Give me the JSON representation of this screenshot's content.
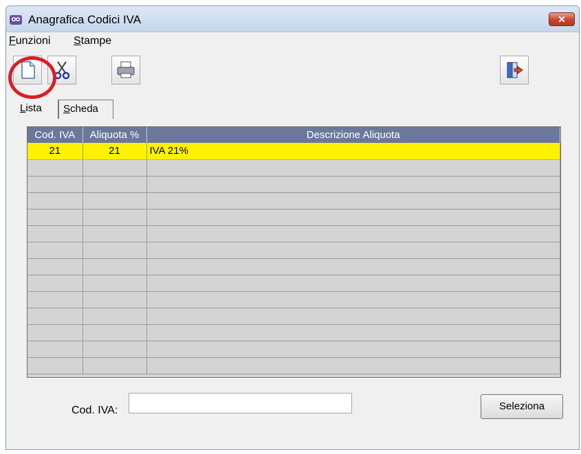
{
  "window": {
    "title": "Anagrafica Codici IVA",
    "close_label": "✕"
  },
  "menu": {
    "items": [
      {
        "accel": "F",
        "rest": "unzioni"
      },
      {
        "accel": "S",
        "rest": "tampe"
      }
    ]
  },
  "toolbar": {
    "icons": [
      "new-document-icon",
      "cut-scissors-icon",
      "printer-icon",
      "exit-door-icon"
    ],
    "highlight_color": "#d81f26"
  },
  "tabs": [
    {
      "accel": "L",
      "rest": "ista"
    },
    {
      "accel": "S",
      "rest": "cheda"
    }
  ],
  "table": {
    "columns": [
      "Cod. IVA",
      "Aliquota %",
      "Descrizione Aliquota"
    ],
    "rows": [
      {
        "cod": "21",
        "aliquota": "21",
        "descrizione": "IVA 21%"
      }
    ],
    "selected_row_color": "#fff200",
    "header_color": "#6c789a"
  },
  "footer": {
    "field_label": "Cod. IVA:",
    "field_value": "",
    "button_label": "Seleziona"
  }
}
